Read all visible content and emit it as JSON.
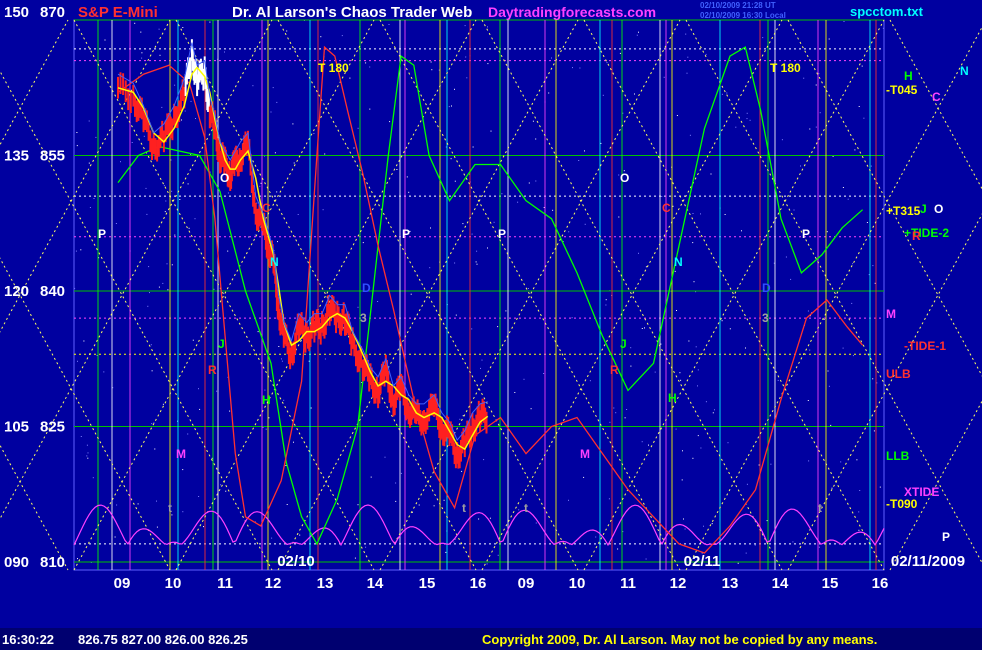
{
  "header": {
    "y_scale_top": "150",
    "price_top": "870",
    "symbol": "S&P E-Mini",
    "title": "Dr. Al Larson's Chaos Trader Web",
    "site": "Daytradingforecasts.com",
    "stamp1": "02/10/2009 21:28 UT",
    "stamp2": "02/10/2009 16:30 Local",
    "file": "spcctom.txt"
  },
  "footer": {
    "time": "16:30:22",
    "quotes": "826.75 827.00 826.00 826.25",
    "copyright": "Copyright 2009, Dr. Al Larson. May not be copied by any means."
  },
  "colors": {
    "background": "#0000a0",
    "price_bars": "#ff2020",
    "moving_avg": "#ffff00",
    "green_line": "#00ff00",
    "red_line": "#ff3030",
    "xtide": "#ff40ff",
    "grid_yellow": "#ffff60"
  },
  "chart_data": {
    "type": "line",
    "title": "S&P E-Mini",
    "price_levels": [
      "870",
      "855",
      "840",
      "825",
      "810"
    ],
    "scale_levels": [
      "150",
      "135",
      "120",
      "105",
      "090"
    ],
    "ylim": [
      810,
      870
    ],
    "day_labels": [
      "02/10",
      "02/11",
      "02/11/2009"
    ],
    "x_ticks": [
      "09",
      "10",
      "11",
      "12",
      "13",
      "14",
      "15",
      "16",
      "09",
      "10",
      "11",
      "12",
      "13",
      "14",
      "15",
      "16"
    ],
    "right_labels": [
      {
        "text": "H",
        "color": "#00ff00"
      },
      {
        "text": "N",
        "color": "#00ffff"
      },
      {
        "text": "C",
        "color": "#ff40ff"
      },
      {
        "text": "-T045",
        "color": "#ffff00"
      },
      {
        "text": "+T315",
        "color": "#ffff00"
      },
      {
        "text": "J",
        "color": "#00ff00"
      },
      {
        "text": "O",
        "color": "#ffffff"
      },
      {
        "text": "+TIDE-2",
        "color": "#00ff00"
      },
      {
        "text": "R",
        "color": "#ff3030"
      },
      {
        "text": "M",
        "color": "#ff40ff"
      },
      {
        "text": "-TIDE-1",
        "color": "#ff3030"
      },
      {
        "text": "ULB",
        "color": "#ff3030"
      },
      {
        "text": "LLB",
        "color": "#00ff00"
      },
      {
        "text": "XTIDE",
        "color": "#ff40ff"
      },
      {
        "text": "-T090",
        "color": "#ffff00"
      },
      {
        "text": "P",
        "color": "#ffffff"
      }
    ],
    "markers": [
      {
        "text": "T 180",
        "color": "#ffff00"
      },
      {
        "text": "T 180",
        "color": "#ffff00"
      },
      {
        "text": "P",
        "color": "#ffffff"
      },
      {
        "text": "P",
        "color": "#ffffff"
      },
      {
        "text": "P",
        "color": "#ffffff"
      },
      {
        "text": "P",
        "color": "#ffffff"
      },
      {
        "text": "O",
        "color": "#ffffff"
      },
      {
        "text": "O",
        "color": "#ffffff"
      },
      {
        "text": "C",
        "color": "#ff3030"
      },
      {
        "text": "C",
        "color": "#ff3030"
      },
      {
        "text": "N",
        "color": "#00ffff"
      },
      {
        "text": "N",
        "color": "#00ffff"
      },
      {
        "text": "D",
        "color": "#3050ff"
      },
      {
        "text": "D",
        "color": "#3050ff"
      },
      {
        "text": "3",
        "color": "#a0a0a0"
      },
      {
        "text": "3",
        "color": "#a0a0a0"
      },
      {
        "text": "J",
        "color": "#00ff00"
      },
      {
        "text": "J",
        "color": "#00ff00"
      },
      {
        "text": "R",
        "color": "#ff3030"
      },
      {
        "text": "R",
        "color": "#ff3030"
      },
      {
        "text": "H",
        "color": "#00ff00"
      },
      {
        "text": "H",
        "color": "#00ff00"
      },
      {
        "text": "M",
        "color": "#ff40ff"
      },
      {
        "text": "M",
        "color": "#ff40ff"
      },
      {
        "text": "t",
        "color": "#a0a0a0"
      },
      {
        "text": "t",
        "color": "#a0a0a0"
      },
      {
        "text": "t",
        "color": "#a0a0a0"
      },
      {
        "text": "t",
        "color": "#a0a0a0"
      }
    ],
    "price_series": [
      {
        "t": 0.0,
        "p": 862.5
      },
      {
        "t": 0.3,
        "p": 861.5
      },
      {
        "t": 0.5,
        "p": 859
      },
      {
        "t": 0.7,
        "p": 856
      },
      {
        "t": 0.9,
        "p": 857
      },
      {
        "t": 1.1,
        "p": 859
      },
      {
        "t": 1.3,
        "p": 862
      },
      {
        "t": 1.45,
        "p": 866
      },
      {
        "t": 1.55,
        "p": 863.5
      },
      {
        "t": 1.7,
        "p": 864
      },
      {
        "t": 1.8,
        "p": 860
      },
      {
        "t": 1.9,
        "p": 858
      },
      {
        "t": 2.0,
        "p": 855
      },
      {
        "t": 2.1,
        "p": 854
      },
      {
        "t": 2.2,
        "p": 853
      },
      {
        "t": 2.3,
        "p": 854
      },
      {
        "t": 2.4,
        "p": 855
      },
      {
        "t": 2.55,
        "p": 856
      },
      {
        "t": 2.7,
        "p": 849
      },
      {
        "t": 2.85,
        "p": 847
      },
      {
        "t": 2.95,
        "p": 845
      },
      {
        "t": 3.05,
        "p": 843
      },
      {
        "t": 3.15,
        "p": 838
      },
      {
        "t": 3.25,
        "p": 835
      },
      {
        "t": 3.4,
        "p": 833
      },
      {
        "t": 3.55,
        "p": 836
      },
      {
        "t": 3.7,
        "p": 835
      },
      {
        "t": 3.85,
        "p": 836
      },
      {
        "t": 4.0,
        "p": 836
      },
      {
        "t": 4.15,
        "p": 838
      },
      {
        "t": 4.3,
        "p": 837
      },
      {
        "t": 4.45,
        "p": 837
      },
      {
        "t": 4.6,
        "p": 834
      },
      {
        "t": 4.8,
        "p": 832
      },
      {
        "t": 4.95,
        "p": 830
      },
      {
        "t": 5.1,
        "p": 829
      },
      {
        "t": 5.25,
        "p": 831
      },
      {
        "t": 5.4,
        "p": 828
      },
      {
        "t": 5.55,
        "p": 829
      },
      {
        "t": 5.7,
        "p": 827
      },
      {
        "t": 5.85,
        "p": 826
      },
      {
        "t": 6.0,
        "p": 826
      },
      {
        "t": 6.2,
        "p": 827
      },
      {
        "t": 6.35,
        "p": 825
      },
      {
        "t": 6.5,
        "p": 824
      },
      {
        "t": 6.65,
        "p": 822
      },
      {
        "t": 6.8,
        "p": 823
      },
      {
        "t": 6.95,
        "p": 825
      },
      {
        "t": 7.1,
        "p": 826
      },
      {
        "t": 7.25,
        "p": 826.25
      }
    ],
    "green_forecast": [
      {
        "t": 0.0,
        "p": 852
      },
      {
        "t": 0.4,
        "p": 855
      },
      {
        "t": 0.8,
        "p": 856
      },
      {
        "t": 1.2,
        "p": 855.5
      },
      {
        "t": 1.6,
        "p": 855
      },
      {
        "t": 2.0,
        "p": 851
      },
      {
        "t": 2.5,
        "p": 840
      },
      {
        "t": 3.0,
        "p": 832
      },
      {
        "t": 3.3,
        "p": 821
      },
      {
        "t": 3.6,
        "p": 815
      },
      {
        "t": 3.9,
        "p": 812
      },
      {
        "t": 4.3,
        "p": 817
      },
      {
        "t": 4.7,
        "p": 825
      },
      {
        "t": 5.0,
        "p": 840
      },
      {
        "t": 5.3,
        "p": 855
      },
      {
        "t": 5.55,
        "p": 866
      },
      {
        "t": 5.8,
        "p": 865
      },
      {
        "t": 6.1,
        "p": 855
      },
      {
        "t": 6.5,
        "p": 850
      },
      {
        "t": 7.0,
        "p": 854
      },
      {
        "t": 7.5,
        "p": 854
      },
      {
        "t": 8.0,
        "p": 850
      },
      {
        "t": 8.5,
        "p": 848
      },
      {
        "t": 9.0,
        "p": 842
      },
      {
        "t": 9.5,
        "p": 835
      },
      {
        "t": 10.0,
        "p": 829
      },
      {
        "t": 10.5,
        "p": 832
      },
      {
        "t": 11.0,
        "p": 845
      },
      {
        "t": 11.5,
        "p": 858
      },
      {
        "t": 12.0,
        "p": 866
      },
      {
        "t": 12.3,
        "p": 867
      },
      {
        "t": 12.6,
        "p": 860
      },
      {
        "t": 13.0,
        "p": 848
      },
      {
        "t": 13.4,
        "p": 842
      },
      {
        "t": 13.8,
        "p": 844
      },
      {
        "t": 14.2,
        "p": 847
      },
      {
        "t": 14.6,
        "p": 849
      }
    ],
    "red_forecast": [
      {
        "t": 0.0,
        "p": 862
      },
      {
        "t": 0.5,
        "p": 864
      },
      {
        "t": 1.0,
        "p": 865
      },
      {
        "t": 1.4,
        "p": 863
      },
      {
        "t": 1.7,
        "p": 857
      },
      {
        "t": 1.9,
        "p": 848
      },
      {
        "t": 2.1,
        "p": 835
      },
      {
        "t": 2.3,
        "p": 822
      },
      {
        "t": 2.5,
        "p": 815
      },
      {
        "t": 2.8,
        "p": 814
      },
      {
        "t": 3.2,
        "p": 819
      },
      {
        "t": 3.6,
        "p": 830
      },
      {
        "t": 3.9,
        "p": 855
      },
      {
        "t": 4.05,
        "p": 867
      },
      {
        "t": 4.25,
        "p": 866
      },
      {
        "t": 4.5,
        "p": 860
      },
      {
        "t": 4.8,
        "p": 853
      },
      {
        "t": 5.1,
        "p": 845
      },
      {
        "t": 5.4,
        "p": 838
      },
      {
        "t": 5.8,
        "p": 828
      },
      {
        "t": 6.2,
        "p": 820
      },
      {
        "t": 6.6,
        "p": 816
      },
      {
        "t": 7.0,
        "p": 824
      },
      {
        "t": 7.5,
        "p": 826
      },
      {
        "t": 8.0,
        "p": 822
      },
      {
        "t": 8.5,
        "p": 825
      },
      {
        "t": 9.0,
        "p": 826
      },
      {
        "t": 9.5,
        "p": 822
      },
      {
        "t": 10.0,
        "p": 818
      },
      {
        "t": 10.5,
        "p": 815
      },
      {
        "t": 11.0,
        "p": 812
      },
      {
        "t": 11.5,
        "p": 811
      },
      {
        "t": 12.0,
        "p": 814
      },
      {
        "t": 12.5,
        "p": 818
      },
      {
        "t": 13.0,
        "p": 828
      },
      {
        "t": 13.5,
        "p": 837
      },
      {
        "t": 13.9,
        "p": 839
      },
      {
        "t": 14.3,
        "p": 836
      },
      {
        "t": 14.6,
        "p": 834
      }
    ]
  }
}
